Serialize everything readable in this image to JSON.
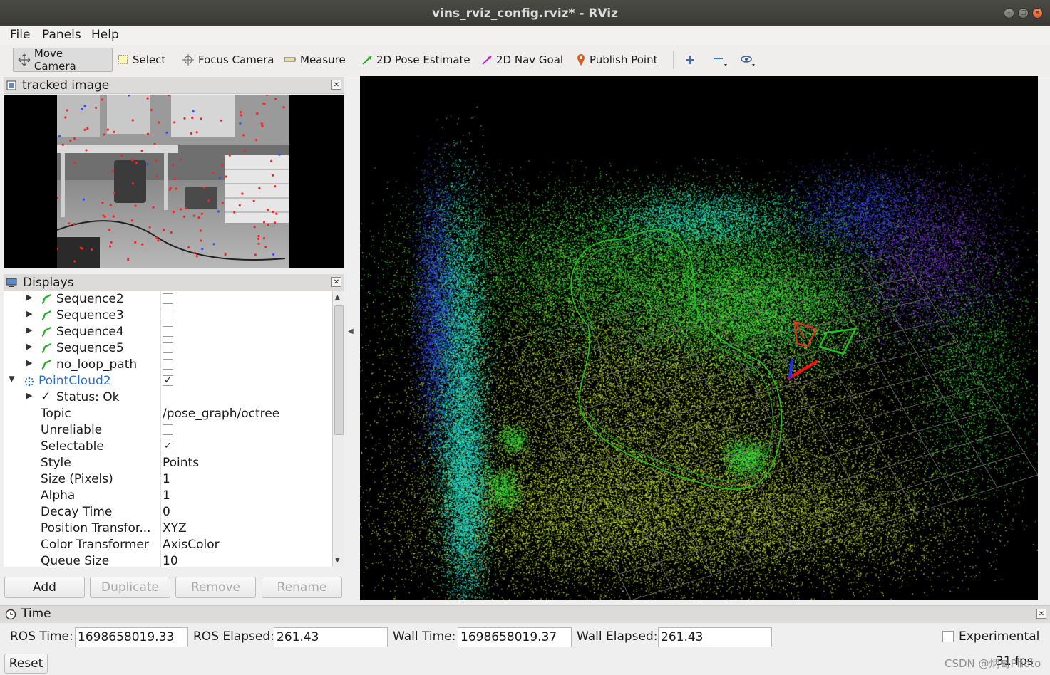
{
  "window": {
    "title": "vins_rviz_config.rviz* - RViz"
  },
  "menu": {
    "file": "File",
    "panels": "Panels",
    "help": "Help"
  },
  "toolbar": {
    "move_camera": "Move Camera",
    "select": "Select",
    "focus_camera": "Focus Camera",
    "measure": "Measure",
    "pose_estimate": "2D Pose Estimate",
    "nav_goal": "2D Nav Goal",
    "publish_point": "Publish Point"
  },
  "tracked_panel": {
    "title": "tracked image"
  },
  "displays": {
    "title": "Displays",
    "items": [
      {
        "label": "Sequence2",
        "checked": false
      },
      {
        "label": "Sequence3",
        "checked": false
      },
      {
        "label": "Sequence4",
        "checked": false
      },
      {
        "label": "Sequence5",
        "checked": false
      },
      {
        "label": "no_loop_path",
        "checked": false
      }
    ],
    "pointcloud": {
      "label": "PointCloud2",
      "checked": true,
      "status": "Status: Ok",
      "props": [
        {
          "name": "Topic",
          "value": "/pose_graph/octree"
        },
        {
          "name": "Unreliable",
          "value": ""
        },
        {
          "name": "Selectable",
          "value": ""
        },
        {
          "name": "Style",
          "value": "Points"
        },
        {
          "name": "Size (Pixels)",
          "value": "1"
        },
        {
          "name": "Alpha",
          "value": "1"
        },
        {
          "name": "Decay Time",
          "value": "0"
        },
        {
          "name": "Position Transfor...",
          "value": "XYZ"
        },
        {
          "name": "Color Transformer",
          "value": "AxisColor"
        },
        {
          "name": "Queue Size",
          "value": "10"
        }
      ]
    },
    "buttons": {
      "add": "Add",
      "duplicate": "Duplicate",
      "remove": "Remove",
      "rename": "Rename"
    }
  },
  "time": {
    "title": "Time",
    "ros_time_label": "ROS Time:",
    "ros_time": "1698658019.33",
    "ros_elapsed_label": "ROS Elapsed:",
    "ros_elapsed": "261.43",
    "wall_time_label": "Wall Time:",
    "wall_time": "1698658019.37",
    "wall_elapsed_label": "Wall Elapsed:",
    "wall_elapsed": "261.43",
    "experimental": "Experimental",
    "reset": "Reset",
    "fps": "31 fps",
    "watermark": "CSDN @炳哥Photo"
  },
  "colors": {
    "accent_link": "#2a6fc7",
    "path_green": "#22c021"
  }
}
